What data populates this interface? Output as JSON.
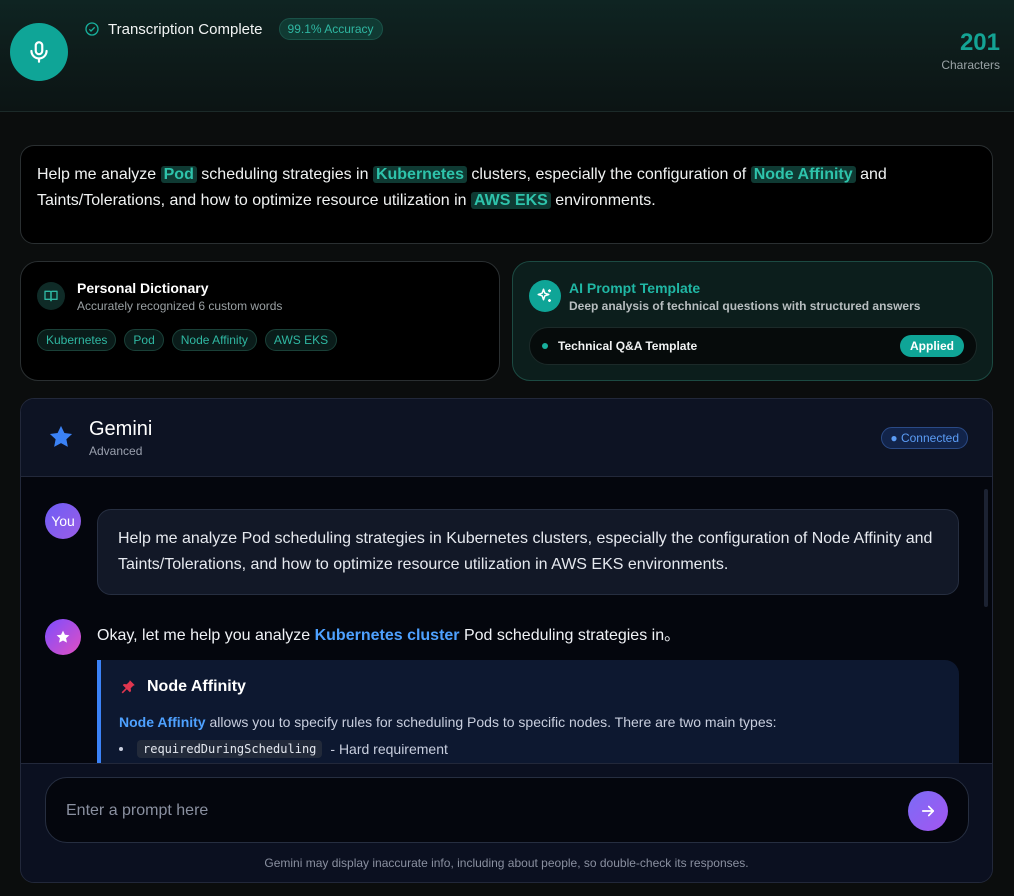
{
  "header": {
    "status": "Transcription Complete",
    "accuracy": "99.1% Accuracy",
    "char_count": "201",
    "char_label": "Characters"
  },
  "transcript": {
    "segments": [
      {
        "text": "Help me analyze ",
        "highlight": false
      },
      {
        "text": "Pod",
        "highlight": true
      },
      {
        "text": " scheduling strategies in ",
        "highlight": false
      },
      {
        "text": "Kubernetes",
        "highlight": true
      },
      {
        "text": " clusters, especially the configuration of ",
        "highlight": false
      },
      {
        "text": "Node Affinity",
        "highlight": true
      },
      {
        "text": " and Taints/Tolerations, and how to optimize resource utilization in ",
        "highlight": false
      },
      {
        "text": "AWS EKS",
        "highlight": true
      },
      {
        "text": " environments.",
        "highlight": false
      }
    ]
  },
  "dictionary": {
    "title": "Personal Dictionary",
    "subtitle": "Accurately recognized 6 custom words",
    "tags": [
      "Kubernetes",
      "Pod",
      "Node Affinity",
      "AWS EKS"
    ]
  },
  "template": {
    "title": "AI Prompt Template",
    "subtitle": "Deep analysis of technical questions with structured answers",
    "name": "Technical Q&A Template",
    "status": "Applied"
  },
  "gemini": {
    "name": "Gemini",
    "mode": "Advanced",
    "connection": "● Connected",
    "user_avatar": "You",
    "user_message": "Help me analyze Pod scheduling strategies in Kubernetes clusters, especially the configuration of Node Affinity and Taints/Tolerations, and how to optimize resource utilization in AWS EKS environments.",
    "ai_intro_before": "Okay, let me help you analyze ",
    "ai_intro_link": "Kubernetes cluster",
    "ai_intro_after": " Pod scheduling strategies in。",
    "section_title": "Node Affinity",
    "section_term": "Node Affinity",
    "section_text": " allows you to specify rules for scheduling Pods to specific nodes. There are two main types:",
    "bullet_code": "requiredDuringScheduling",
    "bullet_text": "- Hard requirement",
    "prompt_placeholder": "Enter a prompt here",
    "disclaimer": "Gemini may display inaccurate info, including about people, so double-check its responses."
  },
  "colors": {
    "accent": "#0fa597",
    "link": "#4ea1ff",
    "send": "#8b5cf6"
  },
  "icons": [
    "microphone-icon",
    "check-circle-icon",
    "book-icon",
    "sparkles-icon",
    "star-icon",
    "pin-icon",
    "arrow-right-icon"
  ]
}
